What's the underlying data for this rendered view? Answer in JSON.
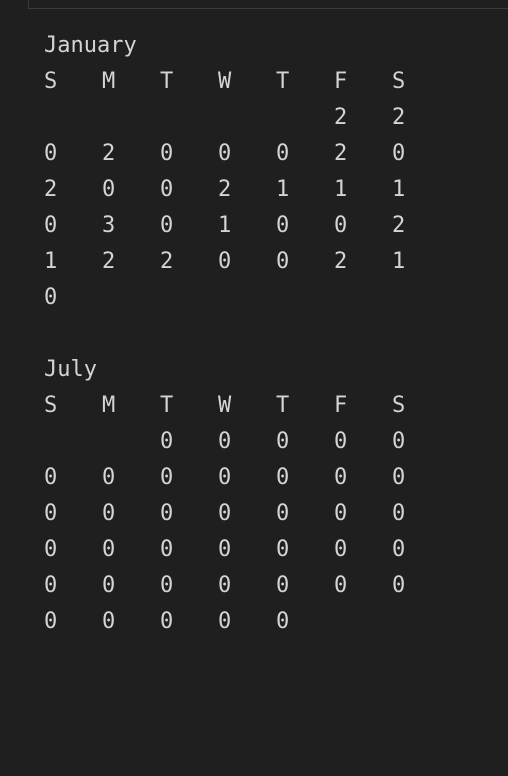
{
  "weekday_headers": [
    "S",
    "M",
    "T",
    "W",
    "T",
    "F",
    "S"
  ],
  "months": [
    {
      "name": "January",
      "rows": [
        [
          "",
          "",
          "",
          "",
          "",
          "2",
          "2"
        ],
        [
          "0",
          "2",
          "0",
          "0",
          "0",
          "2",
          "0"
        ],
        [
          "2",
          "0",
          "0",
          "2",
          "1",
          "1",
          "1"
        ],
        [
          "0",
          "3",
          "0",
          "1",
          "0",
          "0",
          "2"
        ],
        [
          "1",
          "2",
          "2",
          "0",
          "0",
          "2",
          "1"
        ],
        [
          "0",
          "",
          "",
          "",
          "",
          "",
          ""
        ]
      ]
    },
    {
      "name": "July",
      "rows": [
        [
          "",
          "",
          "0",
          "0",
          "0",
          "0",
          "0"
        ],
        [
          "0",
          "0",
          "0",
          "0",
          "0",
          "0",
          "0"
        ],
        [
          "0",
          "0",
          "0",
          "0",
          "0",
          "0",
          "0"
        ],
        [
          "0",
          "0",
          "0",
          "0",
          "0",
          "0",
          "0"
        ],
        [
          "0",
          "0",
          "0",
          "0",
          "0",
          "0",
          "0"
        ],
        [
          "0",
          "0",
          "0",
          "0",
          "0",
          "",
          ""
        ]
      ]
    }
  ]
}
